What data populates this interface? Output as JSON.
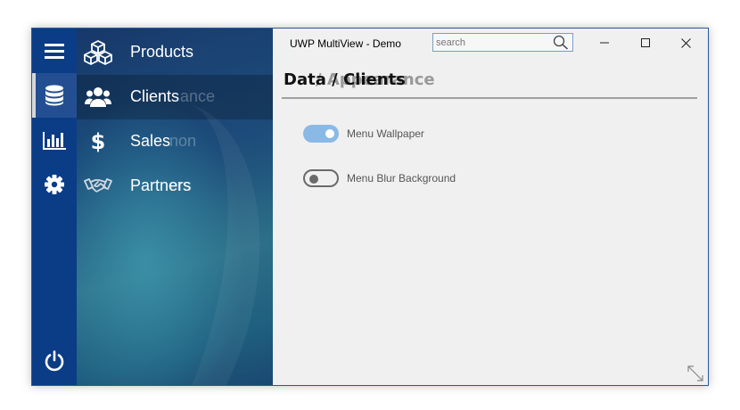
{
  "window": {
    "title": "UWP MultiView - Demo",
    "controls": [
      "minimize-icon",
      "maximize-icon",
      "close-icon"
    ]
  },
  "search": {
    "placeholder": "search",
    "value": ""
  },
  "rail": {
    "items": [
      {
        "icon": "hamburger-menu-icon"
      },
      {
        "icon": "database-icon",
        "active": true
      },
      {
        "icon": "bar-chart-icon"
      },
      {
        "icon": "gear-icon"
      }
    ],
    "footer_icon": "power-icon"
  },
  "nav": {
    "items": [
      {
        "icon": "cubes-icon",
        "label": "Products",
        "ghost": ""
      },
      {
        "icon": "users-icon",
        "label": "Clients",
        "ghost": "ance",
        "active": true
      },
      {
        "icon": "dollar-icon",
        "label": "Sales",
        "ghost": "non"
      },
      {
        "icon": "handshake-icon",
        "label": "Partners",
        "ghost": "ers"
      }
    ]
  },
  "page": {
    "title": "Data / Clients",
    "ghost_title": "/ Appearance",
    "settings": [
      {
        "label": "Menu Wallpaper",
        "on": true
      },
      {
        "label": "Menu Blur Background",
        "on": false
      }
    ]
  },
  "colors": {
    "rail": "#0b3c86",
    "border": "#2b5797",
    "toggle_on": "#8ab9e6",
    "content_bg": "#f0f0f0"
  }
}
